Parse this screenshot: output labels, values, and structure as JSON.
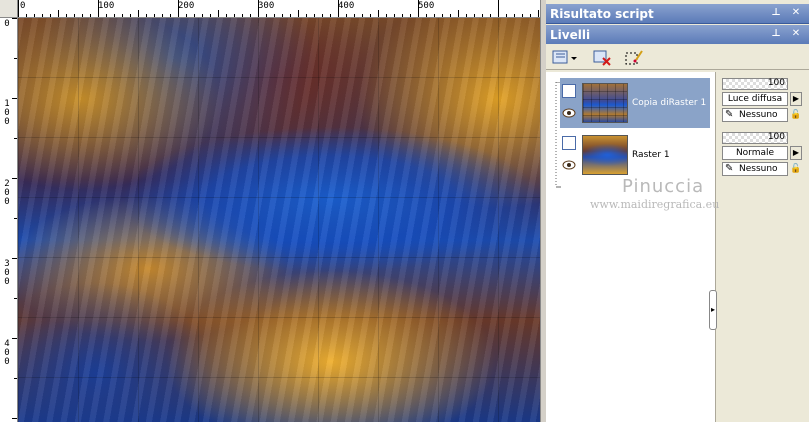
{
  "rulers": {
    "horizontal": [
      "0",
      "100",
      "200",
      "300",
      "400",
      "500"
    ],
    "vertical": [
      "0",
      "1 0 0",
      "2 0 0",
      "3 0 0",
      "4 0 0"
    ]
  },
  "script_panel": {
    "title": "Risultato script",
    "buttons": [
      "pin-icon",
      "close-icon"
    ]
  },
  "layers_panel": {
    "title": "Livelli",
    "toolbar": [
      "new-layer-icon",
      "delete-layer-icon",
      "mask-icon"
    ],
    "layers": [
      {
        "name": "Copia diRaster 1",
        "selected": true,
        "opacity": "100",
        "blend": "Luce diffusa",
        "link": "Nessuno"
      },
      {
        "name": "Raster 1",
        "selected": false,
        "opacity": "100",
        "blend": "Normale",
        "link": "Nessuno"
      }
    ]
  },
  "watermark": {
    "name": "Pinuccia",
    "url": "www.maidiregrafica.eu"
  },
  "colors": {
    "title_bar": "#6c8ac4",
    "selected_row": "#8aa3c8",
    "panel_bg": "#ece9d8"
  }
}
